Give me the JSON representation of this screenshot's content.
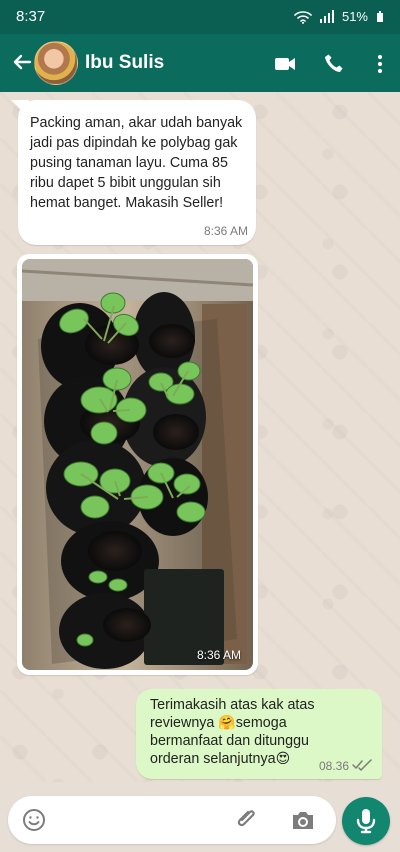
{
  "status": {
    "time": "8:37",
    "battery": "51%"
  },
  "contact": {
    "name": "Ibu Sulis"
  },
  "messages": [
    {
      "direction": "incoming",
      "text": "Packing aman, akar udah banyak jadi pas dipindah ke polybag gak pusing tanaman layu. Cuma 85 ribu dapet 5 bibit unggulan sih hemat banget. Makasih Seller!",
      "time": "8:36 AM"
    },
    {
      "direction": "incoming",
      "type": "image",
      "image_subject": "strawberry seedlings in polybags",
      "time": "8:36 AM"
    },
    {
      "direction": "outgoing",
      "text_parts": [
        "Terimakasih atas kak atas reviewnya ",
        "🤗",
        "semoga bermanfaat dan ditunggu orderan selanjutnya",
        "😍"
      ],
      "time": "08.36",
      "read_status": "double-check"
    }
  ],
  "icons": {
    "back": "arrow-left-icon",
    "video": "video-camera-icon",
    "call": "phone-icon",
    "menu": "more-vertical-icon",
    "emoji": "smile-icon",
    "attach": "paperclip-icon",
    "camera": "camera-icon",
    "voice": "microphone-icon"
  },
  "colors": {
    "header": "#0b6b5c",
    "outgoing_bubble": "#dcf8c6",
    "send_button": "#12866f"
  }
}
